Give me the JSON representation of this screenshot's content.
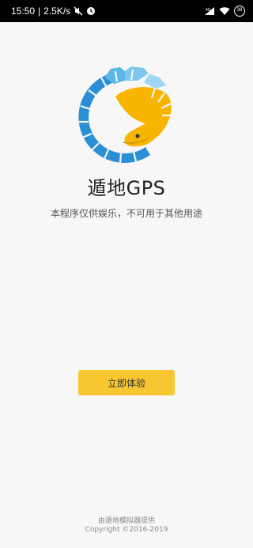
{
  "status_bar": {
    "time": "15:50",
    "speed": "2.5K/s",
    "battery": "38",
    "icons": [
      "mute-icon",
      "alarm-icon",
      "signal-icon",
      "wifi-icon",
      "battery-icon"
    ]
  },
  "app": {
    "name": "遁地GPS",
    "disclaimer": "本程序仅供娱乐，不可用于其他用途",
    "logo_colors": {
      "blue": "#2b8fd6",
      "light_blue": "#5bb6ea",
      "yellow": "#f7b500"
    }
  },
  "actions": {
    "try_label": "立即体验",
    "button_color": "#f7c631"
  },
  "footer": {
    "line1": "由遁地模拟器提供",
    "line2": "Copyright ©2016-2019"
  }
}
